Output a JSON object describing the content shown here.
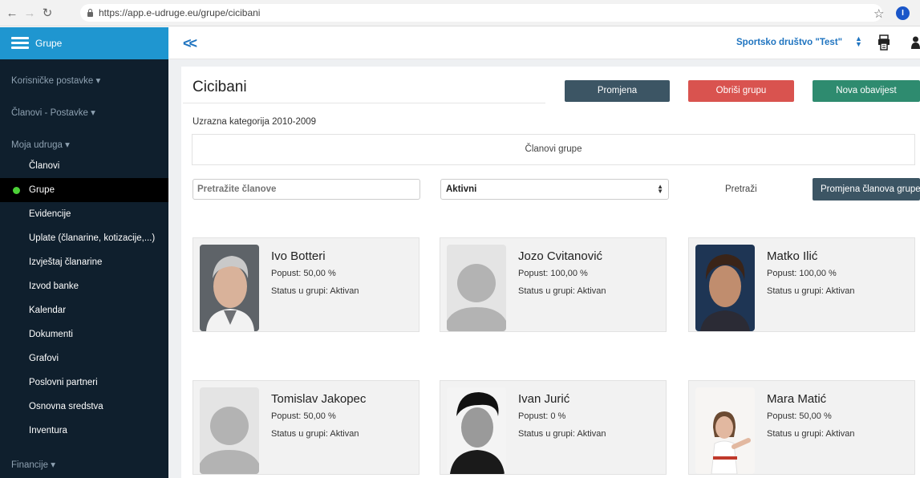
{
  "browser": {
    "url": "https://app.e-udruge.eu/grupe/cicibani",
    "profile_initial": "I"
  },
  "sidebar": {
    "title": "Grupe",
    "sections": {
      "user_settings": "Korisničke postavke ▾",
      "members_settings": "Članovi - Postavke ▾",
      "my_association": "Moja udruga ▾",
      "finance": "Financije ▾"
    },
    "items": [
      {
        "label": "Članovi"
      },
      {
        "label": "Grupe"
      },
      {
        "label": "Evidencije"
      },
      {
        "label": "Uplate (članarine, kotizacije,...)"
      },
      {
        "label": "Izvještaj članarine"
      },
      {
        "label": "Izvod banke"
      },
      {
        "label": "Kalendar"
      },
      {
        "label": "Dokumenti"
      },
      {
        "label": "Grafovi"
      },
      {
        "label": "Poslovni partneri"
      },
      {
        "label": "Osnovna sredstva"
      },
      {
        "label": "Inventura"
      }
    ],
    "active_item": "Grupe"
  },
  "header": {
    "collapse_symbol": "<<",
    "organization": "Sportsko društvo \"Test\""
  },
  "group": {
    "title": "Cicibani",
    "category": "Uzrazna kategorija 2010-2009",
    "members_panel": "Članovi grupe"
  },
  "actions": {
    "change": "Promjena",
    "delete": "Obriši grupu",
    "notice": "Nova obavijest",
    "change_members": "Promjena članova grupe"
  },
  "filters": {
    "search_placeholder": "Pretražite članove",
    "status_selected": "Aktivni",
    "search_label": "Pretraži"
  },
  "members": [
    {
      "name": "Ivo Botteri",
      "discount": "Popust: 50,00 %",
      "status": "Status u grupi: Aktivan",
      "photo": "man-gray-hair-photo"
    },
    {
      "name": "Jozo Cvitanović",
      "discount": "Popust: 100,00 %",
      "status": "Status u grupi: Aktivan",
      "photo": "default-avatar"
    },
    {
      "name": "Matko Ilić",
      "discount": "Popust: 100,00 %",
      "status": "Status u grupi: Aktivan",
      "photo": "teen-boy-photo"
    },
    {
      "name": "Tomislav Jakopec",
      "discount": "Popust: 50,00 %",
      "status": "Status u grupi: Aktivan",
      "photo": "default-avatar"
    },
    {
      "name": "Ivan Jurić",
      "discount": "Popust: 0 %",
      "status": "Status u grupi: Aktivan",
      "photo": "young-man-bw-photo"
    },
    {
      "name": "Mara Matić",
      "discount": "Popust: 50,00 %",
      "status": "Status u grupi: Aktivan",
      "photo": "girl-karate-photo"
    }
  ],
  "colors": {
    "sidebar_bg": "#0f1f2d",
    "sidebar_header": "#1f96d0",
    "link_blue": "#1f74c0",
    "btn_dark": "#3c5564",
    "btn_red": "#d9534f",
    "btn_green": "#2e8b6f",
    "active_dot": "#4cd137"
  }
}
